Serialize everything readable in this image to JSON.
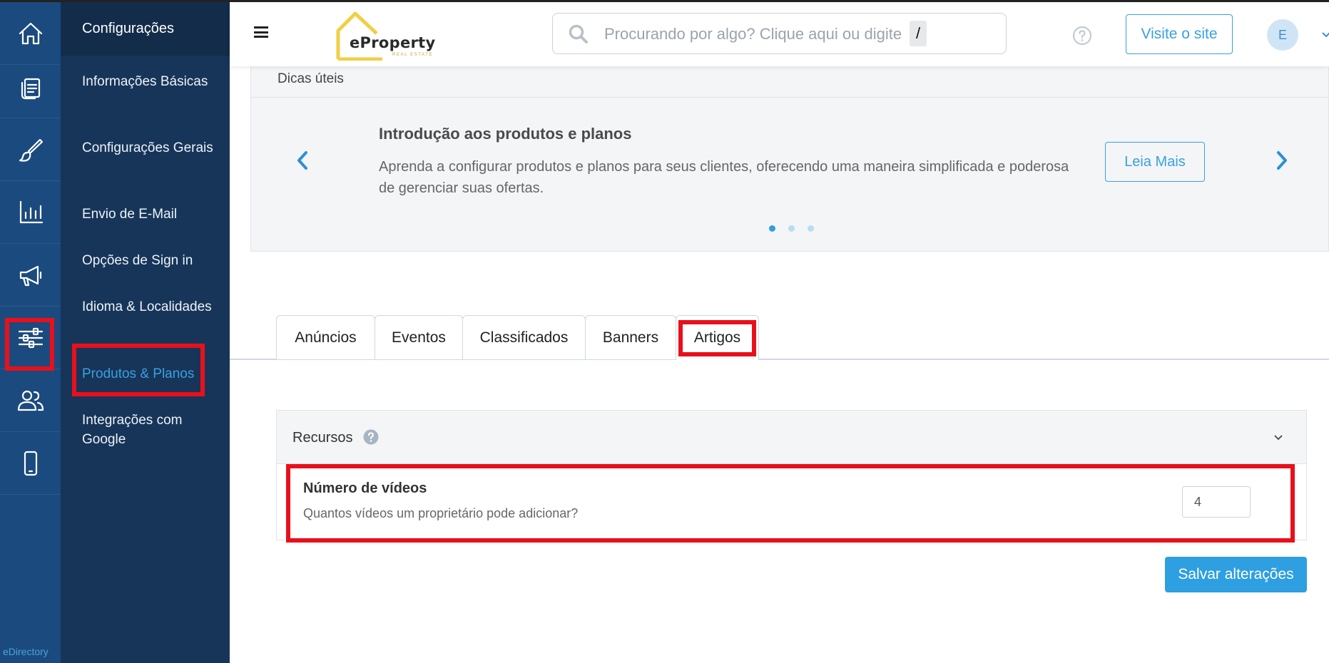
{
  "rail": {
    "items": [
      {
        "icon": "home-icon"
      },
      {
        "icon": "documents-icon"
      },
      {
        "icon": "brush-icon"
      },
      {
        "icon": "bar-chart-icon"
      },
      {
        "icon": "megaphone-icon"
      },
      {
        "icon": "sliders-icon",
        "active": true
      },
      {
        "icon": "users-icon"
      },
      {
        "icon": "mobile-icon"
      }
    ],
    "brand": "eDirectory"
  },
  "sidebar": {
    "title": "Configurações",
    "items": [
      {
        "label": "Informações Básicas"
      },
      {
        "label": "Configurações Gerais"
      },
      {
        "label": "Envio de E-Mail"
      },
      {
        "label": "Opções de Sign in"
      },
      {
        "label": "Idioma & Localidades"
      },
      {
        "label": "Produtos & Planos",
        "active": true
      },
      {
        "label": "Integrações com Google"
      }
    ]
  },
  "topbar": {
    "logo_name": "eProperty",
    "logo_sub": "REAL ESTATE",
    "search_placeholder": "Procurando por algo? Clique aqui ou digite",
    "search_shortcut": "/",
    "visit_label": "Visite o site",
    "avatar_initial": "E"
  },
  "tips": {
    "title": "Dicas úteis",
    "heading": "Introdução aos produtos e planos",
    "text": "Aprenda a configurar produtos e planos para seus clientes, oferecendo uma maneira simplificada e poderosa de gerenciar suas ofertas.",
    "button_label": "Leia Mais",
    "slide_count": 3,
    "active_slide": 1
  },
  "tabs": [
    {
      "label": "Anúncios"
    },
    {
      "label": "Eventos"
    },
    {
      "label": "Classificados"
    },
    {
      "label": "Banners"
    },
    {
      "label": "Artigos",
      "active": true
    }
  ],
  "resources": {
    "title": "Recursos",
    "field_label": "Número de vídeos",
    "field_help": "Quantos vídeos um proprietário pode adicionar?",
    "field_value": "4"
  },
  "save_label": "Salvar alterações",
  "colors": {
    "rail_bg": "#1b4a7e",
    "sidebar_bg": "#163559",
    "accent": "#3aa0e0",
    "highlight": "#e8101b"
  }
}
